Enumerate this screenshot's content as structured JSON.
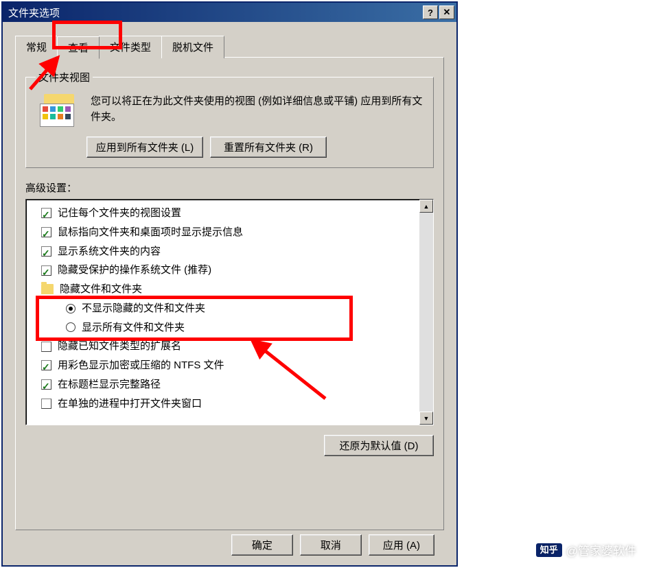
{
  "title": "文件夹选项",
  "tabs": {
    "general": "常规",
    "view": "查看",
    "filetypes": "文件类型",
    "offline": "脱机文件"
  },
  "folder_view": {
    "legend": "文件夹视图",
    "description": "您可以将正在为此文件夹使用的视图 (例如详细信息或平铺) 应用到所有文件夹。",
    "apply_btn": "应用到所有文件夹 (L)",
    "reset_btn": "重置所有文件夹 (R)"
  },
  "advanced_label": "高级设置：",
  "items": [
    {
      "type": "checkbox",
      "checked": true,
      "label": "记住每个文件夹的视图设置"
    },
    {
      "type": "checkbox",
      "checked": true,
      "label": "鼠标指向文件夹和桌面项时显示提示信息"
    },
    {
      "type": "checkbox",
      "checked": true,
      "label": "显示系统文件夹的内容"
    },
    {
      "type": "checkbox",
      "checked": true,
      "label": "隐藏受保护的操作系统文件 (推荐)"
    },
    {
      "type": "folder",
      "label": "隐藏文件和文件夹"
    },
    {
      "type": "radio",
      "selected": true,
      "indent": 2,
      "label": "不显示隐藏的文件和文件夹"
    },
    {
      "type": "radio",
      "selected": false,
      "indent": 2,
      "label": "显示所有文件和文件夹"
    },
    {
      "type": "checkbox",
      "checked": false,
      "label": "隐藏已知文件类型的扩展名"
    },
    {
      "type": "checkbox",
      "checked": true,
      "label": "用彩色显示加密或压缩的 NTFS 文件"
    },
    {
      "type": "checkbox",
      "checked": true,
      "label": "在标题栏显示完整路径"
    },
    {
      "type": "checkbox",
      "checked": false,
      "label": "在单独的进程中打开文件夹窗口"
    }
  ],
  "restore_defaults": "还原为默认值 (D)",
  "buttons": {
    "ok": "确定",
    "cancel": "取消",
    "apply": "应用 (A)"
  },
  "watermark": {
    "logo": "知乎",
    "author": "@管家婆软件"
  },
  "highlights": {
    "tab_highlighted": "查看",
    "radio_group_highlighted": true
  }
}
